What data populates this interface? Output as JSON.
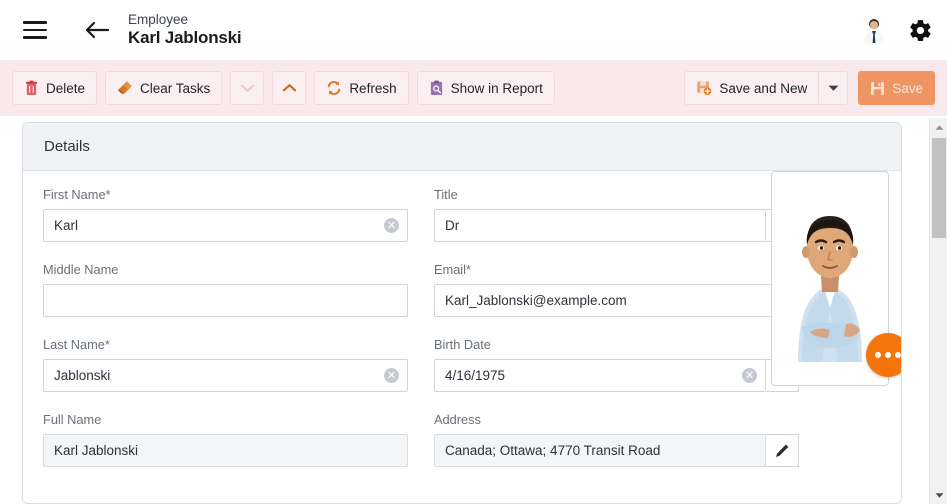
{
  "header": {
    "menu_icon": "hamburger-icon",
    "back_icon": "back-arrow-icon",
    "breadcrumb_label": "Employee",
    "record_title": "Karl Jablonski",
    "avatar_icon": "user-avatar",
    "settings_icon": "gear-icon"
  },
  "toolbar": {
    "delete_label": "Delete",
    "clear_tasks_label": "Clear Tasks",
    "prev_icon": "chevron-down-icon",
    "next_icon": "chevron-up-icon",
    "refresh_label": "Refresh",
    "show_in_report_label": "Show in Report",
    "save_and_new_label": "Save and New",
    "save_dropdown_icon": "caret-down-icon",
    "save_label": "Save",
    "background_color": "#f9e9ec",
    "primary_color": "#ef9564"
  },
  "card": {
    "title": "Details"
  },
  "form": {
    "left": [
      {
        "label": "First Name*",
        "value": "Karl",
        "placeholder": "",
        "clearable": true,
        "readonly": false,
        "adornment": ""
      },
      {
        "label": "Middle Name",
        "value": "",
        "placeholder": "",
        "clearable": false,
        "readonly": false,
        "adornment": ""
      },
      {
        "label": "Last Name*",
        "value": "Jablonski",
        "placeholder": "",
        "clearable": true,
        "readonly": false,
        "adornment": ""
      },
      {
        "label": "Full Name",
        "value": "Karl Jablonski",
        "placeholder": "",
        "clearable": false,
        "readonly": true,
        "adornment": ""
      }
    ],
    "right": [
      {
        "label": "Title",
        "value": "Dr",
        "placeholder": "",
        "clearable": false,
        "readonly": false,
        "adornment": "dropdown-caret-icon"
      },
      {
        "label": "Email*",
        "value": "Karl_Jablonski@example.com",
        "placeholder": "",
        "clearable": true,
        "readonly": false,
        "adornment": ""
      },
      {
        "label": "Birth Date",
        "value": "4/16/1975",
        "placeholder": "",
        "clearable": true,
        "readonly": false,
        "adornment": "calendar-icon"
      },
      {
        "label": "Address",
        "value": "Canada; Ottawa; 4770 Transit Road",
        "placeholder": "",
        "clearable": false,
        "readonly": false,
        "adornment": "pencil-edit-icon"
      }
    ]
  },
  "photo": {
    "alt_name": "employee-photo",
    "fab_icon": "more-options-icon",
    "fab_color": "#f2760c"
  },
  "scrollbar": {
    "up_icon": "scroll-up-arrow",
    "down_icon": "scroll-down-arrow"
  }
}
